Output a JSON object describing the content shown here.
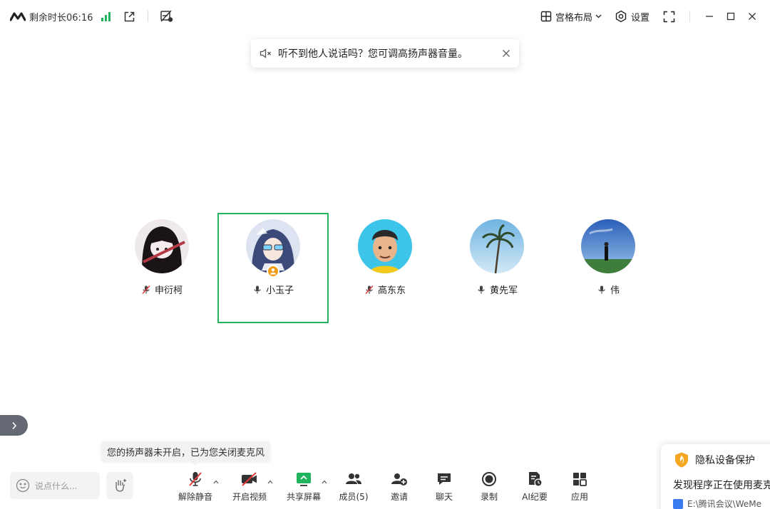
{
  "titlebar": {
    "remaining_time": "剩余时长06:16",
    "layout_label": "宫格布局",
    "settings_label": "设置"
  },
  "notice": {
    "message": "听不到他人说话吗？您可调高扬声器音量。"
  },
  "participants": [
    {
      "name": "申衍柯",
      "mic": "muted"
    },
    {
      "name": "小玉子",
      "mic": "on",
      "active": true,
      "badge": "host"
    },
    {
      "name": "高东东",
      "mic": "muted"
    },
    {
      "name": "黄先军",
      "mic": "on"
    },
    {
      "name": "伟",
      "mic": "on"
    }
  ],
  "tooltip": {
    "text": "您的扬声器未开启，已为您关闭麦克风"
  },
  "chat": {
    "placeholder": "说点什么..."
  },
  "toolbar": {
    "unmute": "解除静音",
    "start_video": "开启视频",
    "share_screen": "共享屏幕",
    "members": "成员(5)",
    "invite": "邀请",
    "chat": "聊天",
    "record": "录制",
    "ai_minutes": "AI纪要",
    "apps": "应用"
  },
  "privacy": {
    "title": "隐私设备保护",
    "desc": "发现程序正在使用麦克",
    "path": "E:\\腾讯会议\\WeMe"
  },
  "colors": {
    "accent_green": "#22b35e",
    "mute_red": "#e23b3b",
    "host_badge": "#f39c12"
  }
}
